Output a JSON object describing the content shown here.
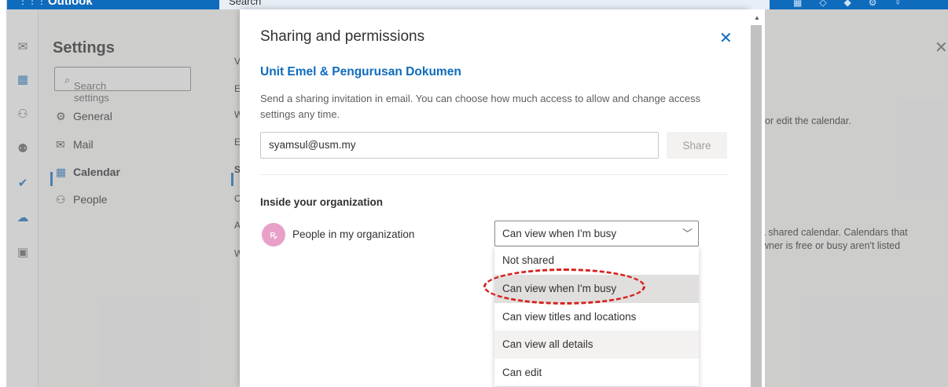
{
  "app": {
    "name": "Outlook",
    "search_placeholder": "Search"
  },
  "rail": {
    "icons": [
      "mail-icon",
      "calendar-icon",
      "people-icon",
      "groups-icon",
      "todo-icon",
      "onedrive-icon",
      "apps-icon"
    ]
  },
  "settings": {
    "title": "Settings",
    "search_placeholder": "Search settings",
    "nav": [
      {
        "label": "General",
        "icon": "gear-icon"
      },
      {
        "label": "Mail",
        "icon": "mail-icon"
      },
      {
        "label": "Calendar",
        "icon": "calendar-icon"
      },
      {
        "label": "People",
        "icon": "people-icon"
      }
    ],
    "sub_nav": [
      "Vie",
      "Eve",
      "We",
      "Eve",
      "Sha",
      "Cu",
      "Acc",
      "Wo"
    ],
    "right_text": {
      "line1": "or edit the calendar.",
      "line2": "a shared calendar. Calendars that",
      "line3": "wner is free or busy aren't listed"
    }
  },
  "modal": {
    "title": "Sharing and permissions",
    "calendar_name": "Unit Emel & Pengurusan Dokumen",
    "description": "Send a sharing invitation in email. You can choose how much access to allow and change access settings any time.",
    "email_value": "syamsul@usm.my",
    "share_label": "Share",
    "section_heading": "Inside your organization",
    "person_label": "People in my organization",
    "selected_permission": "Can view when I'm busy",
    "options": [
      "Not shared",
      "Can view when I'm busy",
      "Can view titles and locations",
      "Can view all details",
      "Can edit"
    ]
  },
  "colors": {
    "accent": "#0f6cbd",
    "annotation": "#d6231f",
    "avatar": "#e8a0c8"
  }
}
